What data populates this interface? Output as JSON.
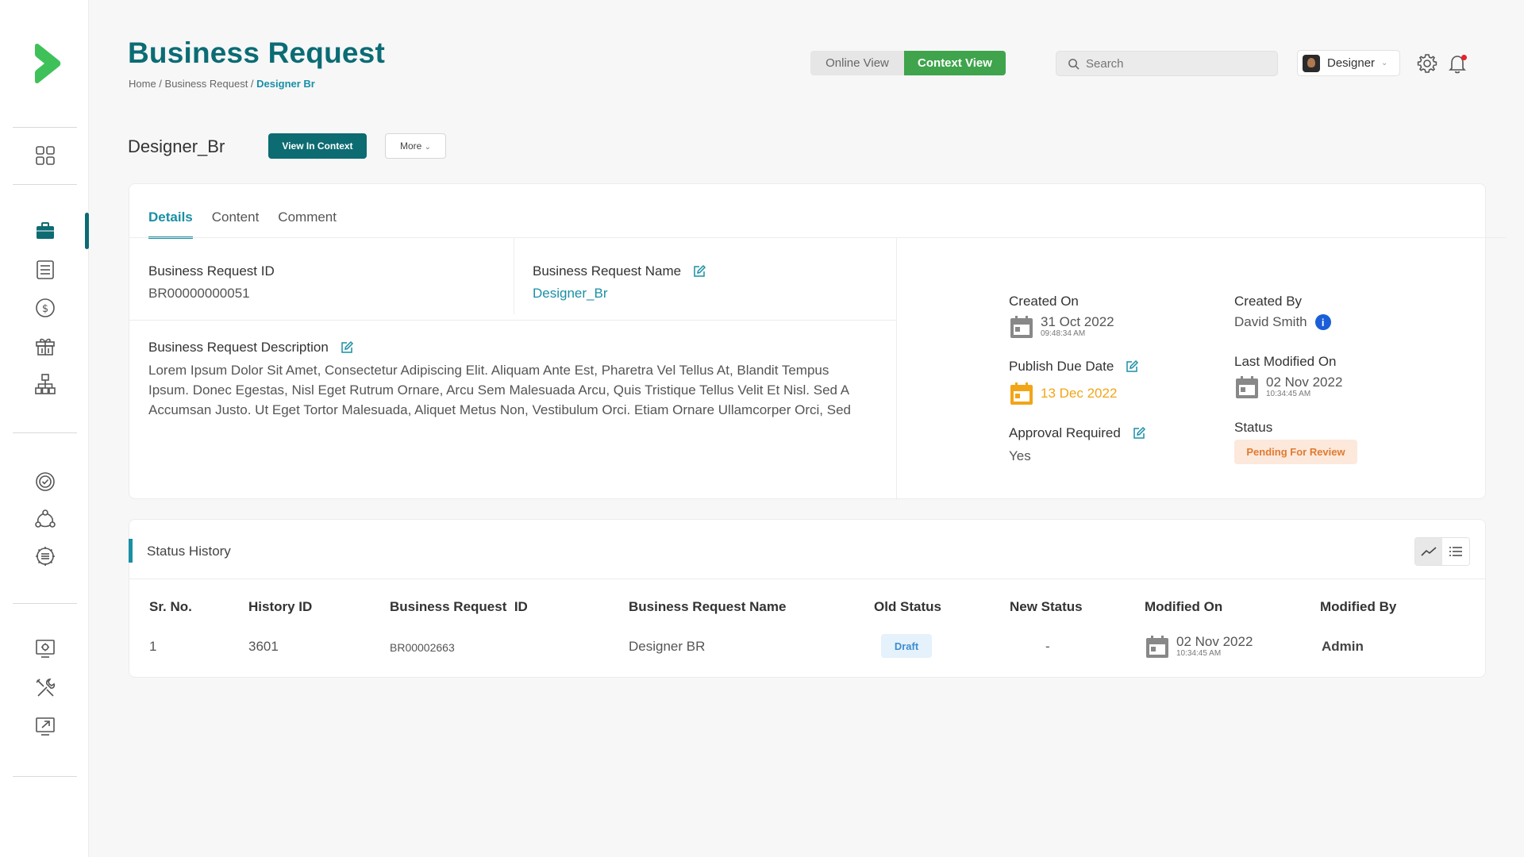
{
  "header": {
    "title": "Business Request",
    "breadcrumb": {
      "home": "Home /",
      "section": "Business Request /",
      "current": "Designer Br"
    },
    "view_toggle": {
      "online": "Online View",
      "context": "Context View"
    },
    "search": {
      "placeholder": "Search"
    },
    "user": {
      "name": "Designer"
    }
  },
  "record": {
    "name": "Designer_Br",
    "view_in_context": "View In Context",
    "more": "More"
  },
  "tabs": [
    "Details",
    "Content",
    "Comment"
  ],
  "details": {
    "id_label": "Business Request ID",
    "id_value": "BR00000000051",
    "name_label": "Business Request Name",
    "name_value": "Designer_Br",
    "desc_label": "Business Request Description",
    "desc_value": "Lorem Ipsum Dolor Sit Amet, Consectetur Adipiscing Elit. Aliquam Ante Est, Pharetra Vel Tellus At, Blandit Tempus Ipsum. Donec Egestas, Nisl Eget Rutrum Ornare, Arcu Sem Malesuada Arcu, Quis Tristique Tellus Velit Et Nisl. Sed A Accumsan Justo. Ut Eget Tortor Malesuada, Aliquet Metus Non, Vestibulum Orci. Etiam Ornare Ullamcorper Orci, Sed"
  },
  "meta": {
    "created_on_label": "Created On",
    "created_on_date": "31 Oct 2022",
    "created_on_time": "09:48:34 AM",
    "created_by_label": "Created By",
    "created_by_value": "David Smith",
    "publish_label": "Publish Due Date",
    "publish_date": "13 Dec 2022",
    "last_mod_label": "Last Modified On",
    "last_mod_date": "02 Nov 2022",
    "last_mod_time": "10:34:45 AM",
    "approval_label": "Approval Required",
    "approval_value": "Yes",
    "status_label": "Status",
    "status_value": "Pending For Review"
  },
  "history": {
    "title": "Status History",
    "columns": [
      "Sr. No.",
      "History ID",
      "Business Request  ID",
      "Business Request Name",
      "Old Status",
      "New Status",
      "Modified On",
      "Modified By"
    ],
    "rows": [
      {
        "sr": "1",
        "history_id": "3601",
        "br_id": "BR00002663",
        "br_name": "Designer BR",
        "old_status": "Draft",
        "new_status": "-",
        "mod_date": "02 Nov 2022",
        "mod_time": "10:34:45 AM",
        "mod_by": "Admin"
      }
    ]
  },
  "colors": {
    "brand": "#0b6c74",
    "accent": "#1a8fa5",
    "context_green": "#3fa44c",
    "publish_orange": "#f2a516",
    "pending_bg": "#fde8dc",
    "pending_fg": "#e07b2f"
  },
  "icons": [
    "logo-icon",
    "dashboard-icon",
    "briefcase-icon",
    "document-icon",
    "dollar-icon",
    "gift-icon",
    "hierarchy-icon",
    "check-circle-icon",
    "share-icon",
    "settings-chip-icon",
    "monitor-settings-icon",
    "tools-icon",
    "external-link-icon",
    "search-icon",
    "gear-icon",
    "bell-icon",
    "edit-icon",
    "calendar-icon",
    "info-icon",
    "chart-line-icon",
    "list-icon"
  ]
}
